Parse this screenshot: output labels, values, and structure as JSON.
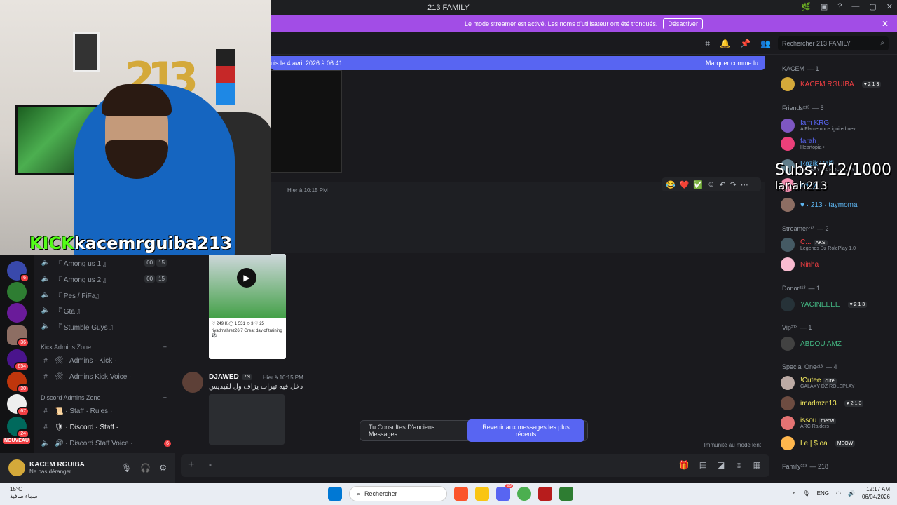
{
  "window": {
    "title": "213 FAMILY"
  },
  "streamer_bar": {
    "message": "Le mode streamer est activé. Les noms d'utilisateur ont été tronqués.",
    "button": "Désactiver"
  },
  "search": {
    "placeholder": "Rechercher 213 FAMILY"
  },
  "new_messages": {
    "text": "uis le 4 avril 2026 à 06:41",
    "mark_read": "Marquer comme lu"
  },
  "overlay": {
    "kick_prefix": "KICK",
    "kick_handle": "kacemrguiba213",
    "subs": "Subs:712/1000",
    "user": "lanah213"
  },
  "servers": {
    "badges": [
      "6",
      "36",
      "654",
      "30",
      "67",
      "24"
    ],
    "new_label": "NOUVEAU"
  },
  "channels": {
    "voice": [
      {
        "name": "『 Among us 1 』",
        "c1": "00",
        "c2": "15"
      },
      {
        "name": "『 Among us 2 』",
        "c1": "00",
        "c2": "15"
      },
      {
        "name": "『 Pes / FiFa』"
      },
      {
        "name": "『 Gta 』"
      },
      {
        "name": "『 Stumble Guys 』"
      }
    ],
    "cat_kick": "Kick Admins Zone",
    "kick_items": [
      "🛠 · Admins · Kick ·",
      "🛠 · Admins Kick Voice ·"
    ],
    "cat_discord": "Discord Admins Zone",
    "discord_items": [
      "📜 · Staff · Rules ·",
      "🛡 · Discord · Staff ·",
      "🔊 · Discord Staff Voice ·"
    ],
    "staff_voice_badge": "6"
  },
  "user": {
    "name": "KACEM RGUIBA",
    "status": "Ne pas déranger"
  },
  "messages": {
    "m1_time": "Hier à 10:15 PM",
    "m2_author": "DJAWED",
    "m2_tag": "7N",
    "m2_time": "Hier à 10:15 PM",
    "m2_text": "دخل فيه تيرات يزاف ول لفيديس",
    "post_stats": "♡ 249 K   ◯ 1 531   ⟲ 3   ♡ 25",
    "post_caption": "riyadmahrez26.7 Great day of training ⚽",
    "reactions": [
      "😂",
      "❤️",
      "✅"
    ]
  },
  "toast": {
    "text": "Tu Consultes D'anciens Messages",
    "button": "Revenir aux messages les plus récents"
  },
  "slowmode": "Immunité au mode lent",
  "members": {
    "groups": [
      {
        "cat": "KACEM",
        "count": "— 1"
      },
      {
        "cat": "Friends²¹³",
        "count": "— 5"
      },
      {
        "cat": "Streamer²¹³",
        "count": "— 2"
      },
      {
        "cat": "Donor²¹³",
        "count": "— 1"
      },
      {
        "cat": "Vip²¹³",
        "count": "— 1"
      },
      {
        "cat": "Special One²¹³",
        "count": "— 4"
      },
      {
        "cat": "Family²¹³",
        "count": "— 218"
      }
    ],
    "list": [
      {
        "name": "KACEM RGUIBA",
        "tag": "♥ 2 1 3",
        "sub": "",
        "color": "#f23f43"
      },
      {
        "name": "Iam KRG",
        "tag": "",
        "sub": "A Flame once ignited nev...",
        "color": "#5865f2"
      },
      {
        "name": "farah",
        "tag": "",
        "sub": "Heartopia •",
        "color": "#5865f2"
      },
      {
        "name": "Razik Haifi",
        "tag": "",
        "sub": "GALAXY DZ ROLEPLAY",
        "color": "#5eb6f2"
      },
      {
        "name": "Kımy",
        "tag": "",
        "sub": "",
        "color": "#5eb6f2"
      },
      {
        "name": "♥ · 213 · taymoma",
        "tag": "",
        "sub": "",
        "color": "#5eb6f2"
      },
      {
        "name": "C...",
        "tag": "AKS",
        "sub": "Legends Dz RolePlay 1.0",
        "color": "#f23f43"
      },
      {
        "name": "Ninha",
        "tag": "",
        "sub": "",
        "color": "#f23f43"
      },
      {
        "name": "YACINEEEE",
        "tag": "♥ 2 1 3",
        "sub": "",
        "color": "#43b581"
      },
      {
        "name": "ABDOU AMZ",
        "tag": "",
        "sub": "",
        "color": "#43b581"
      },
      {
        "name": "!Cutee",
        "tag": "cute",
        "sub": "GALAXY DZ ROLEPLAY",
        "color": "#f2e85e"
      },
      {
        "name": "imadmzn13",
        "tag": "♥ 2 1 3",
        "sub": "",
        "color": "#f2e85e"
      },
      {
        "name": "issou",
        "tag": "meow",
        "sub": "ARC Raiders",
        "color": "#f2e85e"
      },
      {
        "name": "Le | $ oa",
        "tag": "MEOW",
        "sub": "",
        "color": "#f2e85e"
      }
    ]
  },
  "taskbar": {
    "temp": "15°C",
    "weather": "سماء صافية",
    "search": "Rechercher",
    "lang": "ENG",
    "time": "12:17 AM",
    "date": "06/04/2026",
    "discord_badge": "99"
  }
}
